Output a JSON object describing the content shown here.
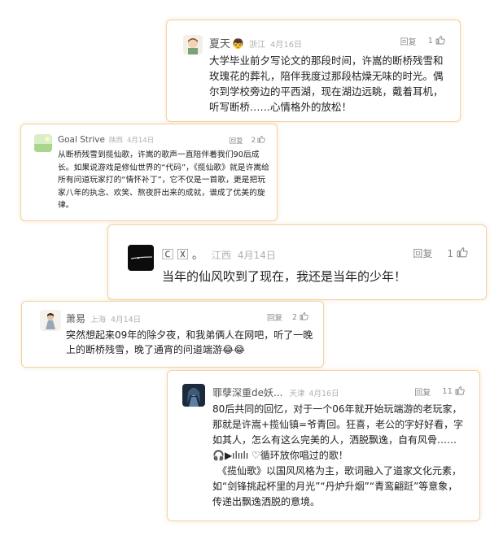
{
  "ui": {
    "reply_label": "回复"
  },
  "comments": [
    {
      "username": "夏天",
      "location": "浙江",
      "date": "4月16日",
      "likes": "1",
      "paragraphs": [
        "大学毕业前夕写论文的那段时间，许嵩的断桥残雪和玫瑰花的葬礼，陪伴我度过那段枯燥无味的时光。偶尔到学校旁边的平西湖，现在湖边远眺，戴着耳机，听写断桥……心情格外的放松！"
      ]
    },
    {
      "username": "Goal Strive",
      "location": "陕西",
      "date": "4月14日",
      "likes": "2",
      "paragraphs": [
        "从断桥残雪到揽仙歌，许嵩的歌声一直陪伴着我们90后成长。如果说游戏是修仙世界的“代码”，《揽仙歌》就是许嵩给所有问道玩家打的“情怀补丁”，它不仅是一首歌，更是把玩家八年的执念、欢笑、熬夜肝出来的成就，谱成了优美的旋律。"
      ]
    },
    {
      "username": "🄲 🅇 。",
      "location": "江西",
      "date": "4月14日",
      "likes": "1",
      "paragraphs": [
        "当年的仙风吹到了现在，我还是当年的少年！"
      ]
    },
    {
      "username": "萧易",
      "location": "上海",
      "date": "4月14日",
      "likes": "2",
      "paragraphs": [
        "突然想起来09年的除夕夜，和我弟俩人在网吧，听了一晚上的断桥残雪，晚了通宵的问道端游😂😂"
      ]
    },
    {
      "username": "罪孽深重de妖...",
      "location": "天津",
      "date": "4月16日",
      "likes": "11",
      "paragraphs": [
        "80后共同的回忆，对于一个06年就开始玩端游的老玩家，那就是许嵩+揽仙镇=爷青回。狂喜，老公的字好好看，字如其人，怎么有这么完美的人，洒脱飘逸，自有风骨……🎧▶ılıılı ♡循环放你唱过的歌！",
        "　《揽仙歌》以国风风格为主，歌词融入了道家文化元素，如“剑锋挑起杯里的月光”“丹炉升烟”“青鸾翩跹”等意象，传递出飘逸洒脱的意境。"
      ]
    }
  ]
}
